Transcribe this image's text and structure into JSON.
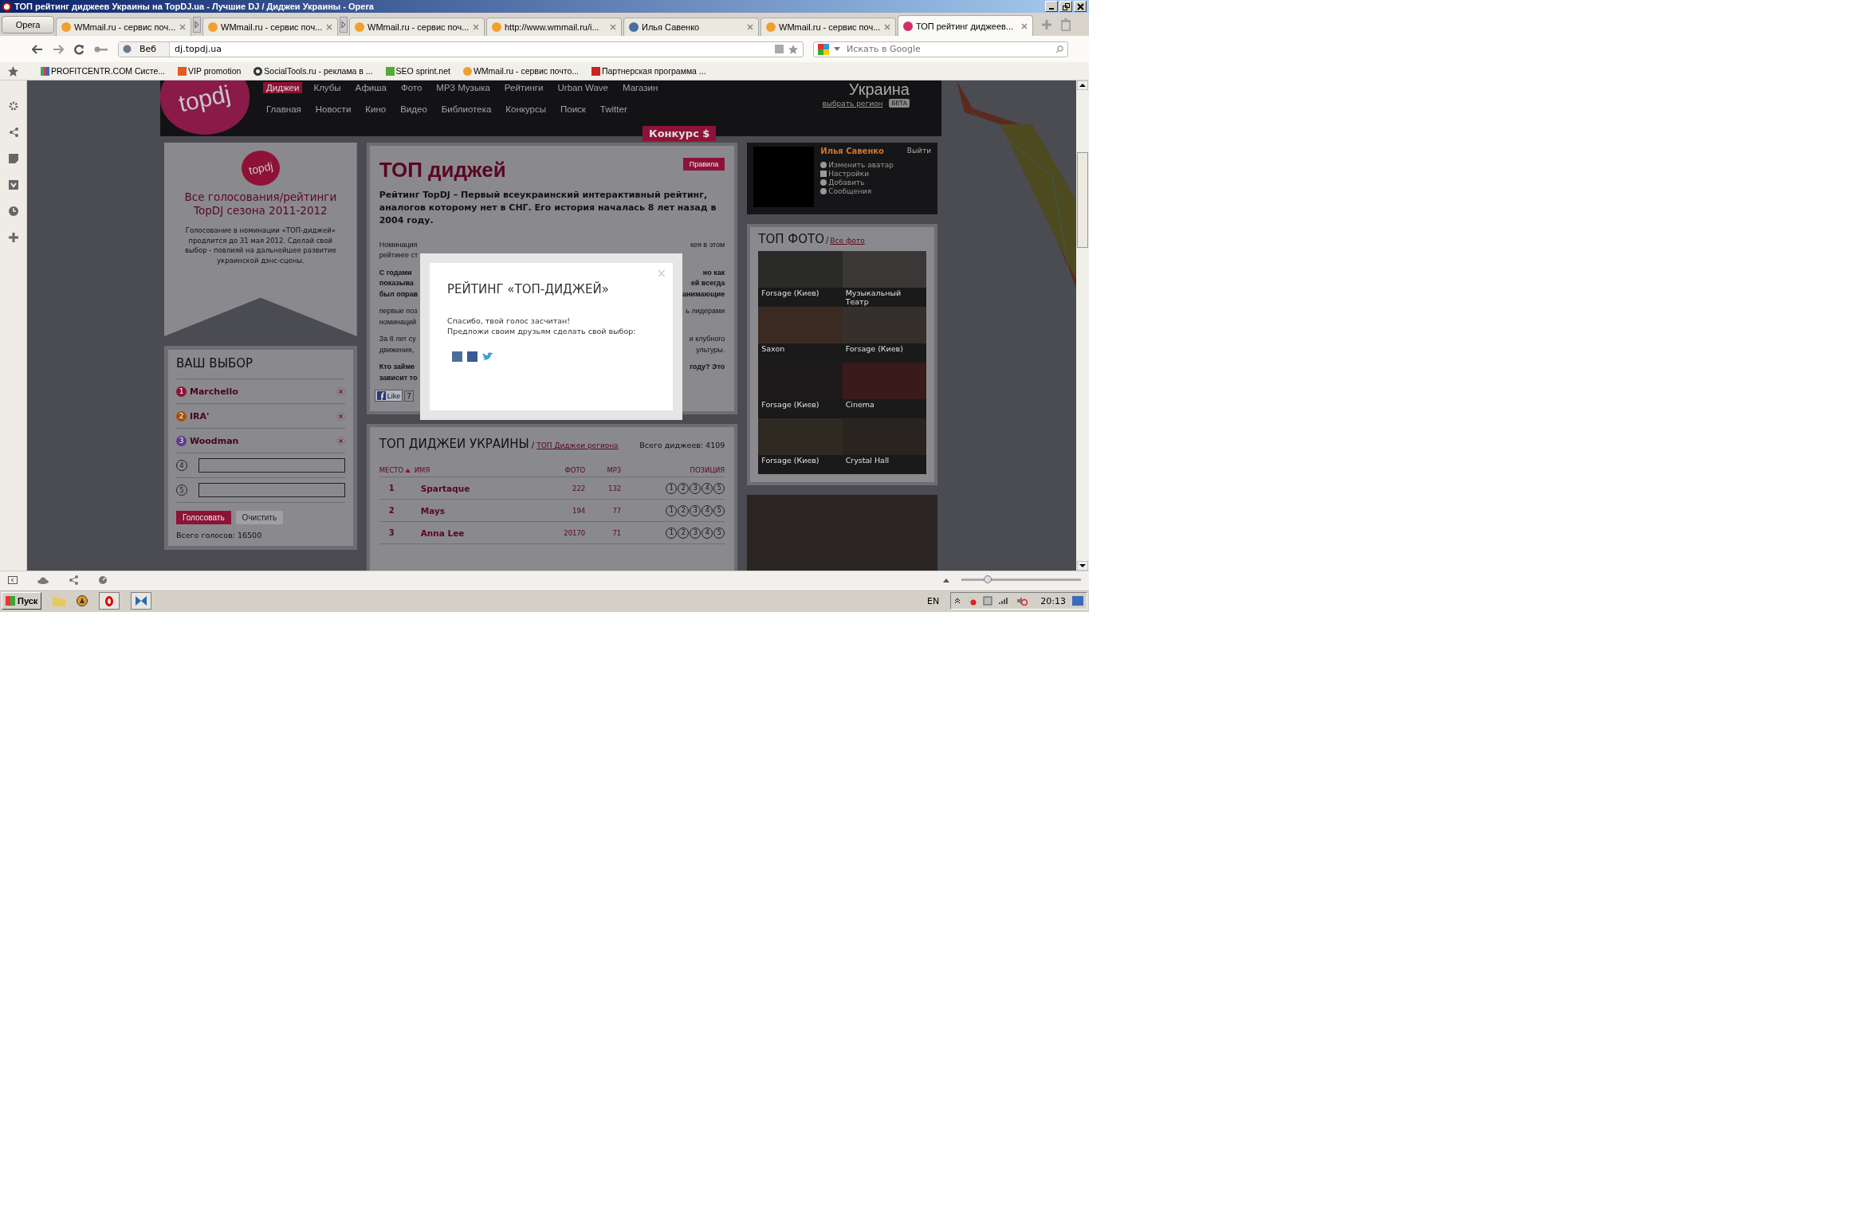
{
  "window": {
    "title": "ТОП рейтинг диджеев Украины на TopDJ.ua - Лучшие DJ / Диджеи Украины - Opera"
  },
  "opera_button": "Opera",
  "tabs": [
    {
      "title": "WMmail.ru - сервис поч...",
      "kind": "mail",
      "selected": false,
      "arrow": true
    },
    {
      "title": "WMmail.ru - сервис поч...",
      "kind": "mail",
      "selected": false,
      "arrow": true
    },
    {
      "title": "WMmail.ru - сервис поч...",
      "kind": "mail",
      "selected": false,
      "arrow": false
    },
    {
      "title": "http://www.wmmail.ru/i...",
      "kind": "mail",
      "selected": false,
      "arrow": false
    },
    {
      "title": "Илья Савенко",
      "kind": "vk",
      "selected": false,
      "arrow": false
    },
    {
      "title": "WMmail.ru - сервис поч...",
      "kind": "mail",
      "selected": false,
      "arrow": false
    },
    {
      "title": "ТОП рейтинг диджеев...",
      "kind": "topdj",
      "selected": true,
      "arrow": false
    }
  ],
  "address": {
    "mode": "Веб",
    "url": "dj.topdj.ua"
  },
  "search": {
    "placeholder": "Искать в Google"
  },
  "bookmarks": [
    {
      "label": "PROFITCENTR.COM Систе...",
      "kind": "chart"
    },
    {
      "label": "VIP promotion",
      "kind": "burst"
    },
    {
      "label": "SocialTools.ru - реклама в ...",
      "kind": "ring"
    },
    {
      "label": "SEO sprint.net",
      "kind": "seo"
    },
    {
      "label": "WMmail.ru - сервис почто...",
      "kind": "mail"
    },
    {
      "label": "Партнерская программа ...",
      "kind": "star"
    }
  ],
  "zoom": {
    "level": 0.22
  },
  "site": {
    "logo": "topdj",
    "nav_top": [
      {
        "label": "Диджеи",
        "selected": true
      },
      {
        "label": "Клубы",
        "selected": false
      },
      {
        "label": "Афиша",
        "selected": false
      },
      {
        "label": "Фото",
        "selected": false
      },
      {
        "label": "MP3 Музыка",
        "selected": false
      },
      {
        "label": "Рейтинги",
        "selected": false
      },
      {
        "label": "Urban Wave",
        "selected": false
      },
      {
        "label": "Магазин",
        "selected": false
      }
    ],
    "nav_bottom": [
      "Главная",
      "Новости",
      "Кино",
      "Видео",
      "Библиотека",
      "Конкурсы",
      "Поиск",
      "Twitter"
    ],
    "region": {
      "name": "Украина",
      "link": "выбрать регион",
      "badge": "БЕТА"
    },
    "contest": "Конкурс $",
    "promo": {
      "logo": "topdj",
      "title": "Все голосования/рейтинги TopDJ сезона 2011-2012",
      "text": "Голосование в номинации «ТОП-диджей» продлится до 31 мая 2012. Сделай свой выбор - повлияй на дальнейшее развитие украинской дэнс-сцены."
    },
    "vote": {
      "title": "ВАШ ВЫБОР",
      "choices": [
        {
          "number": "1",
          "name": "Marchello",
          "color": "#8e1237"
        },
        {
          "number": "2",
          "name": "IRA'",
          "color": "#a4520e"
        },
        {
          "number": "3",
          "name": "Woodman",
          "color": "#5f3a8c"
        }
      ],
      "slots": [
        "4",
        "5"
      ],
      "vote_button": "Голосовать",
      "clear_button": "Очистить",
      "total": "Всего голосов: 16500"
    },
    "main": {
      "title": "ТОП диджей",
      "rules_button": "Правила",
      "lead": "Рейтинг TopDJ – Первый всеукраинский интерактивный рейтинг, аналогов которому нет в СНГ. Его история началась 8 лет назад в 2004 году.",
      "paragraphs": [
        {
          "bold": false,
          "lines": [
            {
              "left": "Номинация",
              "right": "кея в этом"
            },
            {
              "left": "рейтинге ст"
            }
          ]
        },
        {
          "bold": true,
          "lines": [
            {
              "left": "С годами",
              "right": "но как"
            },
            {
              "left": "показыва",
              "right": "ей всегда"
            },
            {
              "left": "был оправ",
              "right": "анимающие"
            }
          ]
        },
        {
          "bold": false,
          "lines": [
            {
              "left": "первые поз",
              "right": "ь лидерами"
            },
            {
              "left": "номинаций"
            }
          ]
        },
        {
          "bold": false,
          "lines": [
            {
              "left": "За 8 лет су",
              "right": "и клубного"
            },
            {
              "left": "движения,",
              "right": "ультуры."
            }
          ]
        },
        {
          "bold": true,
          "lines": [
            {
              "left": "Кто займе",
              "right": "году? Это"
            },
            {
              "left": "зависит то"
            }
          ]
        }
      ],
      "like_button": "Like",
      "like_count": "7"
    },
    "ranking": {
      "title": "ТОП ДИДЖЕИ УКРАИНЫ",
      "separator": "/",
      "link": "ТОП Диджеи региона",
      "total": "Всего диджеев: 4109",
      "columns": [
        "МЕСТО",
        "ИМЯ",
        "ФОТО",
        "MP3",
        "ПОЗИЦИЯ"
      ],
      "rows": [
        {
          "place": "1",
          "name": "Spartaque",
          "photos": "222",
          "mp3": "132",
          "positions": [
            "1",
            "2",
            "3",
            "4",
            "5"
          ]
        },
        {
          "place": "2",
          "name": "Mays",
          "photos": "194",
          "mp3": "77",
          "positions": [
            "1",
            "2",
            "3",
            "4",
            "5"
          ]
        },
        {
          "place": "3",
          "name": "Anna Lee",
          "photos": "20170",
          "mp3": "71",
          "positions": [
            "1",
            "2",
            "3",
            "4",
            "5"
          ]
        }
      ]
    },
    "user": {
      "name": "Илья Савенко",
      "logout": "Выйти",
      "menu": [
        {
          "label": "Изменить аватар",
          "kind": "person"
        },
        {
          "label": "Настройки",
          "kind": "tool"
        },
        {
          "label": "Добавить",
          "kind": "plus"
        },
        {
          "label": "Сообщения",
          "kind": "mail"
        }
      ]
    },
    "top_photo": {
      "title": "ТОП ФОТО",
      "separator": "/",
      "link": "Все фото",
      "photos": [
        {
          "caption": "Forsage (Киев)"
        },
        {
          "caption": "Музыкальный Театр"
        },
        {
          "caption": "Saxon"
        },
        {
          "caption": "Forsage (Киев)"
        },
        {
          "caption": "Forsage (Киев)"
        },
        {
          "caption": "Cinema"
        },
        {
          "caption": "Forsage (Киев)"
        },
        {
          "caption": "Crystal Hall"
        }
      ]
    }
  },
  "modal": {
    "title": "РЕЙТИНГ «ТОП-ДИДЖЕЙ»",
    "close": "×",
    "lines": [
      "Спасибо, твой голос засчитан!",
      "Предложи своим друзьям сделать свой выбор:"
    ],
    "share": [
      {
        "kind": "vk"
      },
      {
        "kind": "facebook"
      },
      {
        "kind": "twitter"
      }
    ]
  },
  "taskbar": {
    "start": "Пуск",
    "language": "EN",
    "time": "20:13"
  }
}
